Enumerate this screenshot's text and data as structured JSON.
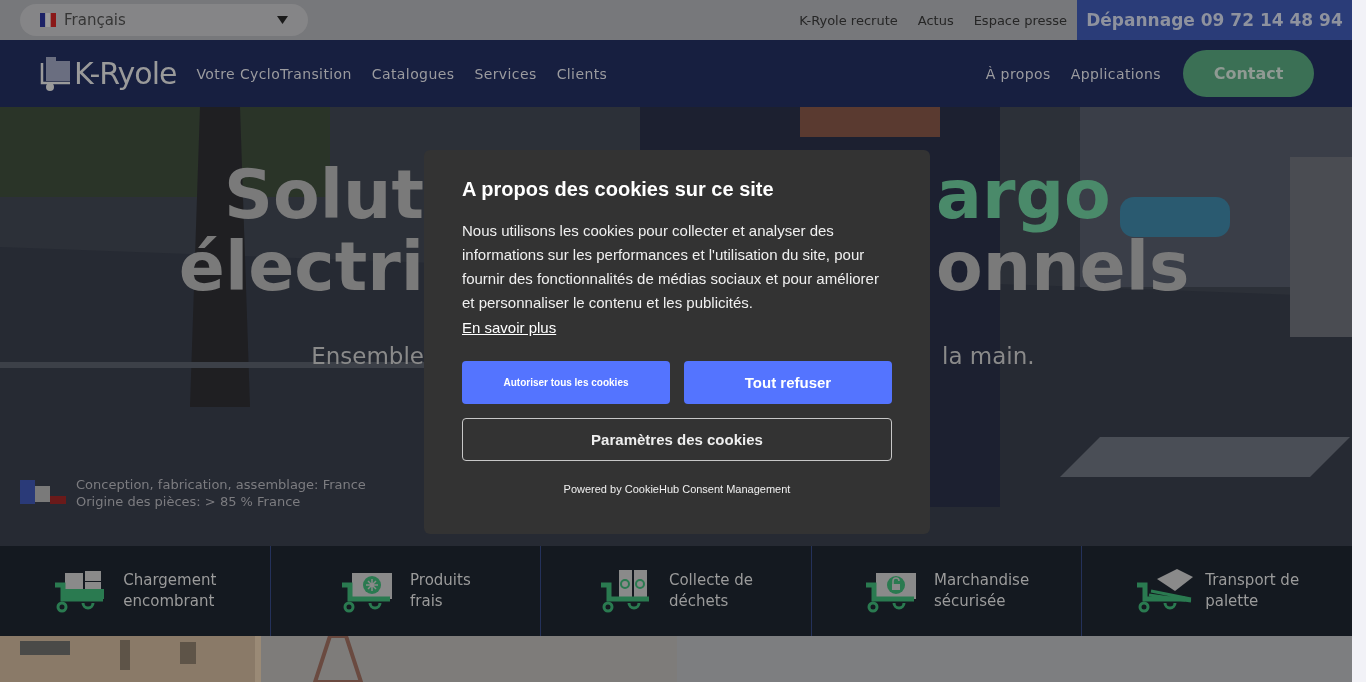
{
  "language_selector": {
    "value": "Français"
  },
  "top_links": [
    "K-Ryole recrute",
    "Actus",
    "Espace presse"
  ],
  "hotline": "Dépannage 09 72 14 48 94",
  "nav": {
    "logo": "K-Ryole",
    "left": [
      "Votre CycloTransition",
      "Catalogues",
      "Services",
      "Clients"
    ],
    "right": [
      "À propos",
      "Applications"
    ],
    "cta": "Contact"
  },
  "hero": {
    "title_lines": [
      {
        "left": {
          "text": "Solut",
          "accent": false
        },
        "right": {
          "text": "argo",
          "accent": true
        }
      },
      {
        "left": {
          "text": "électri",
          "accent": false
        },
        "right": {
          "text": "onnels",
          "accent": false
        }
      }
    ],
    "subtitle": {
      "left": "Ensemble",
      "right": "la main."
    },
    "origin": [
      "Conception, fabrication, assemblage: France",
      "Origine des pièces: > 85 % France"
    ]
  },
  "features": [
    {
      "kind": "boxes",
      "label_lines": [
        "Chargement",
        "encombrant"
      ]
    },
    {
      "kind": "fridge",
      "label_lines": [
        "Produits",
        "frais"
      ]
    },
    {
      "kind": "bins",
      "label_lines": [
        "Collecte de",
        "déchets"
      ]
    },
    {
      "kind": "lock",
      "label_lines": [
        "Marchandise",
        "sécurisée"
      ]
    },
    {
      "kind": "pallet",
      "label_lines": [
        "Transport de",
        "palette"
      ]
    }
  ],
  "cookie_dialog": {
    "title": "A propos des cookies sur ce site",
    "body": "Nous utilisons les cookies pour collecter et analyser des informations sur les performances et l'utilisation du site, pour fournir des fonctionnalités de médias sociaux et pour améliorer et personnaliser le contenu et les publicités.",
    "link": "En savoir plus",
    "buttons": [
      {
        "label": "Autoriser tous les cookies",
        "kind": "accept"
      },
      {
        "label": "Tout refuser",
        "kind": "reject"
      },
      {
        "label": "Paramètres des cookies",
        "kind": "settings"
      }
    ],
    "footer": "Powered by CookieHub Consent Management"
  }
}
